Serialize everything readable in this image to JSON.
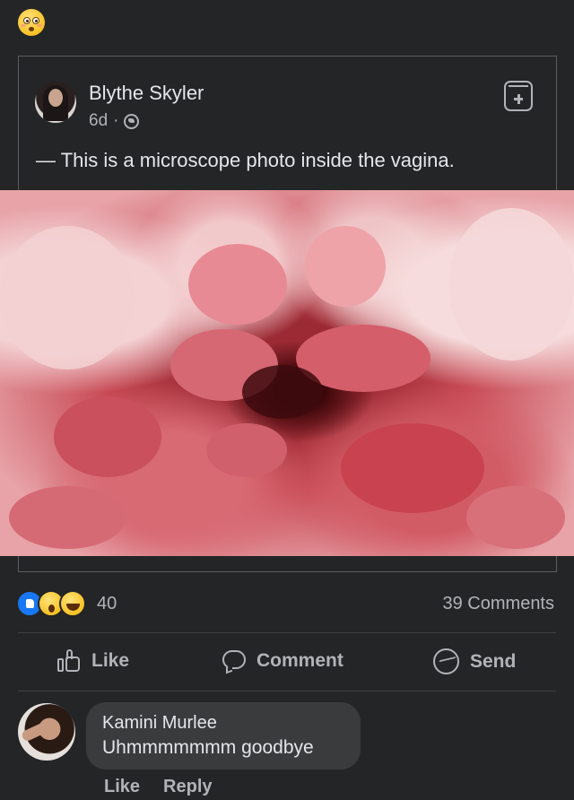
{
  "post": {
    "author": "Blythe Skyler",
    "time": "6d",
    "separator": "·",
    "text": "— This is a microscope photo inside the vagina."
  },
  "stats": {
    "reaction_count": "40",
    "comments_count": "39 Comments"
  },
  "actions": {
    "like": "Like",
    "comment": "Comment",
    "send": "Send"
  },
  "comment": {
    "author": "Kamini Murlee",
    "text": "Uhmmmmmmm goodbye",
    "like": "Like",
    "reply": "Reply"
  },
  "icons": {
    "top_emoji": "flushed-face-icon",
    "privacy": "globe-icon",
    "save": "save-icon",
    "reactions": [
      "like-reaction-icon",
      "wow-reaction-icon",
      "haha-reaction-icon"
    ]
  },
  "colors": {
    "background": "#242526",
    "text_primary": "#e4e6eb",
    "text_secondary": "#b0b3b8",
    "comment_bubble": "#3a3b3c",
    "like_blue": "#1877f2"
  }
}
